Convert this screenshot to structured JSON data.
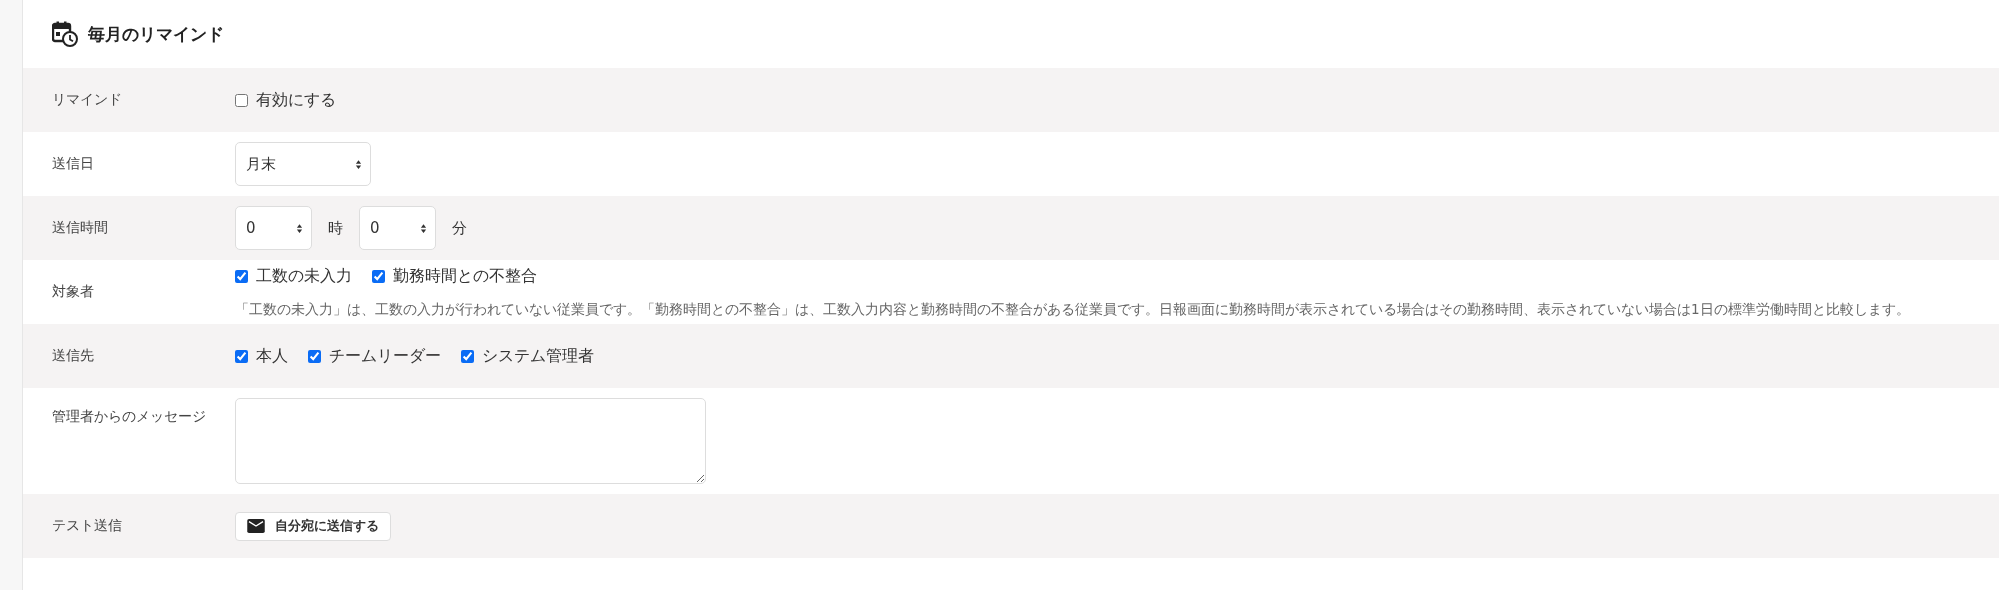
{
  "title": "毎月のリマインド",
  "rows": [
    {
      "kind": "checkboxes",
      "label": "リマインド",
      "options": [
        {
          "label": "有効にする",
          "checked": false
        }
      ]
    },
    {
      "kind": "select",
      "label": "送信日",
      "selects": [
        {
          "value": "月末"
        }
      ]
    },
    {
      "kind": "select",
      "label": "送信時間",
      "selects": [
        {
          "value": "0",
          "unit": "時"
        },
        {
          "value": "0",
          "unit": "分"
        }
      ]
    },
    {
      "kind": "checkboxes",
      "label": "対象者",
      "options": [
        {
          "label": "工数の未入力",
          "checked": true
        },
        {
          "label": "勤務時間との不整合",
          "checked": true
        }
      ],
      "note": "「工数の未入力」は、工数の入力が行われていない従業員です。「勤務時間との不整合」は、工数入力内容と勤務時間の不整合がある従業員です。日報画面に勤務時間が表示されている場合はその勤務時間、表示されていない場合は1日の標準労働時間と比較します。"
    },
    {
      "kind": "checkboxes",
      "label": "送信先",
      "options": [
        {
          "label": "本人",
          "checked": true
        },
        {
          "label": "チームリーダー",
          "checked": true
        },
        {
          "label": "システム管理者",
          "checked": true
        }
      ]
    },
    {
      "kind": "textarea",
      "label": "管理者からのメッセージ"
    },
    {
      "kind": "button",
      "label": "テスト送信",
      "button": "自分宛に送信する"
    }
  ]
}
